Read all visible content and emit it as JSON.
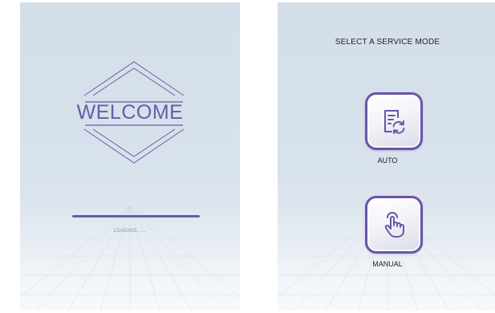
{
  "welcome_screen": {
    "title": "WELCOME",
    "loading_text": "LOADING......",
    "progress": 1.0
  },
  "service_mode_screen": {
    "heading": "SELECT A SERVICE MODE",
    "options": [
      {
        "label": "AUTO",
        "icon": "document-refresh-icon"
      },
      {
        "label": "MANUAL",
        "icon": "hand-pointer-icon"
      }
    ]
  },
  "colors": {
    "accent": "#6a5aa8",
    "screen_background": "#d8e2ec"
  }
}
